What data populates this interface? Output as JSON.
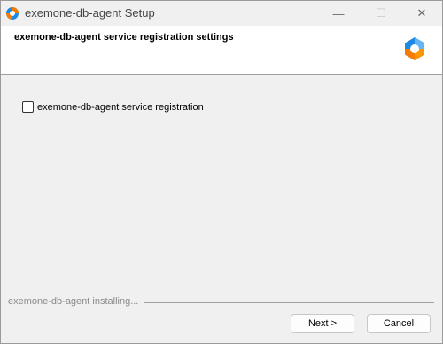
{
  "window": {
    "title": "exemone-db-agent Setup",
    "icon": "app-logo-icon",
    "controls": {
      "minimize_glyph": "—",
      "maximize_glyph": "☐",
      "close_glyph": "✕"
    }
  },
  "header": {
    "title": "exemone-db-agent service registration settings",
    "logo": "exemone-logo-icon"
  },
  "options": {
    "service_registration": {
      "label": "exemone-db-agent service registration",
      "checked": false
    }
  },
  "footer": {
    "status": "exemone-db-agent installing...",
    "next_label": "Next >",
    "cancel_label": "Cancel"
  },
  "colors": {
    "logo_blue": "#1e88e5",
    "logo_orange": "#f57c00",
    "logo_light_blue": "#64b5f6"
  }
}
